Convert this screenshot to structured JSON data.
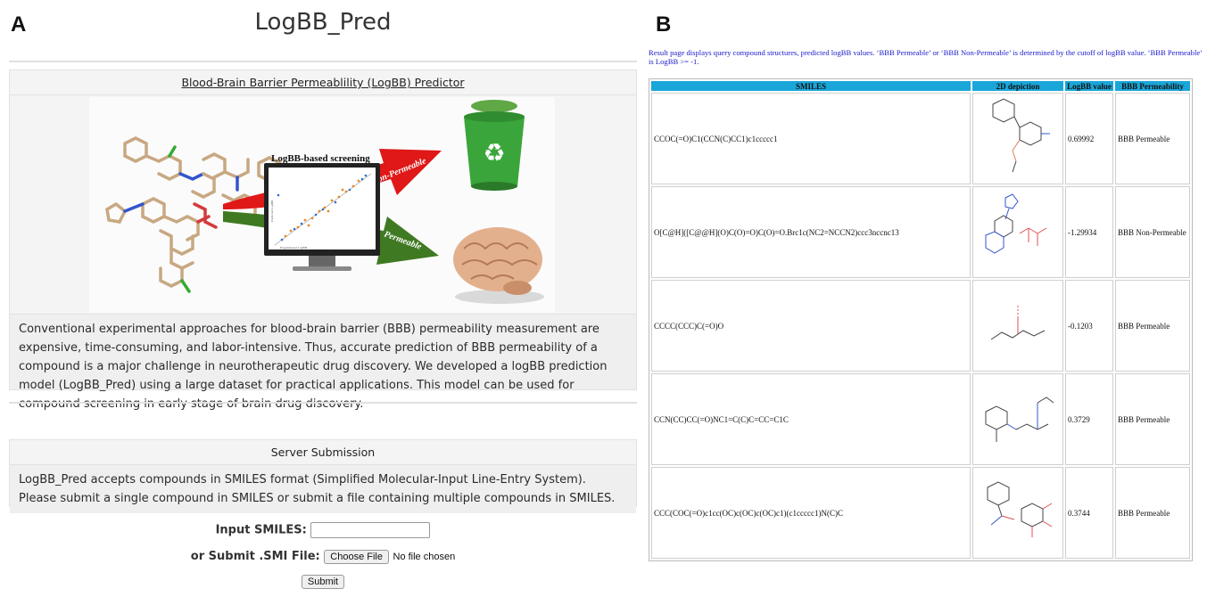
{
  "panels": {
    "left_letter": "A",
    "right_letter": "B"
  },
  "left": {
    "title": "LogBB_Pred",
    "predictor_heading": "Blood-Brain Barrier Permeablility (LogBB) Predictor",
    "graphic": {
      "screen_title": "LogBB-based screening",
      "arrow_top": "Non-Permeable",
      "arrow_bottom": "Permeable",
      "plot_x_label": "Experimental LogBB",
      "plot_y_label": "Predicted LogBB"
    },
    "description": "Conventional experimental approaches for blood-brain barrier (BBB) permeability measurement are expensive, time-consuming, and labor-intensive. Thus, accurate prediction of BBB permeability of a compound is a major challenge in neurotherapeutic drug discovery. We developed a logBB prediction model (LogBB_Pred) using a large dataset for practical applications. This model can be used for compound screening in early stage of brain drug discovery.",
    "submission": {
      "heading": "Server Submission",
      "text": "LogBB_Pred accepts compounds in SMILES format (Simplified Molecular-Input Line-Entry System). Please submit a single compound in SMILES or submit a file containing multiple compounds in SMILES.",
      "smiles_label": "Input SMILES:",
      "smiles_value": "",
      "file_label": "or Submit .SMI File:",
      "choose_file_label": "Choose File",
      "no_file_text": "No file chosen",
      "submit_label": "Submit"
    }
  },
  "right": {
    "note": "Result page displays query compound structures, predicted logBB values. ‘BBB Permeable’ or ‘BBB Non-Permeable’ is determined by the cutoff of logBB value. ‘BBB Permeable’ is LogBB >= -1.",
    "columns": [
      "SMILES",
      "2D depiction",
      "LogBB value",
      "BBB Permeability"
    ],
    "rows": [
      {
        "smiles": "CCOC(=O)C1(CCN(C)CC1)c1ccccc1",
        "logbb": "0.69992",
        "permeability": "BBB Permeable"
      },
      {
        "smiles": "O[C@H]([C@@H](O)C(O)=O)C(O)=O.Brc1c(NC2=NCCN2)ccc3nccnc13",
        "logbb": "-1.29934",
        "permeability": "BBB Non-Permeable"
      },
      {
        "smiles": "CCCC(CCC)C(=O)O",
        "logbb": "-0.1203",
        "permeability": "BBB Permeable"
      },
      {
        "smiles": "CCN(CC)CC(=O)NC1=C(C)C=CC=C1C",
        "logbb": "0.3729",
        "permeability": "BBB Permeable"
      },
      {
        "smiles": "CCC(COC(=O)c1cc(OC)c(OC)c(OC)c1)(c1ccccc1)N(C)C",
        "logbb": "0.3744",
        "permeability": "BBB Permeable"
      }
    ]
  },
  "colors": {
    "header_cyan": "#1aa6d8",
    "note_blue": "#1a1acc",
    "arrow_red": "#e01818",
    "arrow_green": "#3f7a22",
    "bin_green": "#3aa53a"
  }
}
